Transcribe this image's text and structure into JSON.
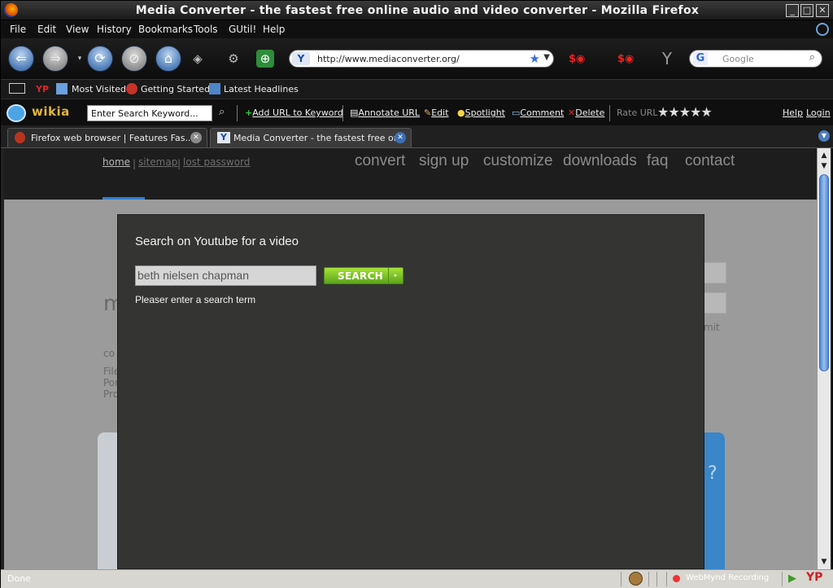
{
  "window": {
    "title": "Media Converter - the fastest free online audio and video converter - Mozilla Firefox"
  },
  "menu": [
    "File",
    "Edit",
    "View",
    "History",
    "Bookmarks",
    "Tools",
    "GUtil!",
    "Help"
  ],
  "nav": {
    "url": "http://www.mediaconverter.org/",
    "search_placeholder": "Google"
  },
  "bookmarks": {
    "yp": "YP",
    "most_visited": "Most Visited",
    "getting_started": "Getting Started",
    "latest_headlines": "Latest Headlines"
  },
  "wikia": {
    "logo": "wikia",
    "keyword_placeholder": "Enter Search Keyword...",
    "add_url": "Add URL to Keyword",
    "annotate": "Annotate URL",
    "edit": "Edit",
    "spotlight": "Spotlight",
    "comment": "Comment",
    "delete": "Delete",
    "rate": "Rate URL",
    "stars": "★★★★★",
    "help": "Help",
    "login": "Login"
  },
  "tabs": [
    {
      "label": "Firefox web browser | Features Fas..."
    },
    {
      "label": "Media Converter - the fastest free onli..."
    }
  ],
  "site": {
    "links": [
      "home",
      "sitemap",
      "lost password"
    ],
    "nav": [
      "convert",
      "sign up",
      "customize",
      "downloads",
      "faq",
      "contact"
    ],
    "under_fragments": [
      "m",
      "co",
      "File",
      "Por",
      "Pro",
      "mit",
      "?"
    ]
  },
  "modal": {
    "title": "Search on Youtube for a video",
    "input_value": "beth nielsen chapman",
    "button": "SEARCH",
    "message": "Pleaser enter a search term"
  },
  "status": {
    "text": "Done",
    "recording": "WebMynd Recording",
    "yp": "YP"
  }
}
